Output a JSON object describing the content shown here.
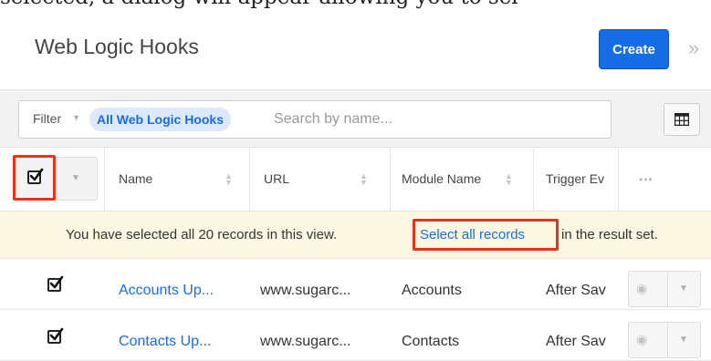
{
  "doc_text": "selected, a dialog will appear allowing you to sel",
  "header": {
    "title": "Web Logic Hooks",
    "create_label": "Create",
    "collapse_icon": "»"
  },
  "filter": {
    "label": "Filter",
    "active_filter": "All Web Logic Hooks",
    "search_placeholder": "Search by name..."
  },
  "table": {
    "columns": [
      "Name",
      "URL",
      "Module Name",
      "Trigger Ev"
    ],
    "actions_menu": "•••",
    "notice": {
      "prefix": "You have selected all 20 records in this view.",
      "link": "Select all records",
      "suffix": "in the result set."
    },
    "rows": [
      {
        "checked": true,
        "name": "Accounts Up...",
        "url": "www.sugarc...",
        "module": "Accounts",
        "trigger": "After Sav"
      },
      {
        "checked": true,
        "name": "Contacts Up...",
        "url": "www.sugarc...",
        "module": "Contacts",
        "trigger": "After Sav"
      }
    ]
  },
  "colors": {
    "accent": "#176de5",
    "highlight_box": "#e8321a",
    "notice_bg": "#fcf8e3"
  }
}
